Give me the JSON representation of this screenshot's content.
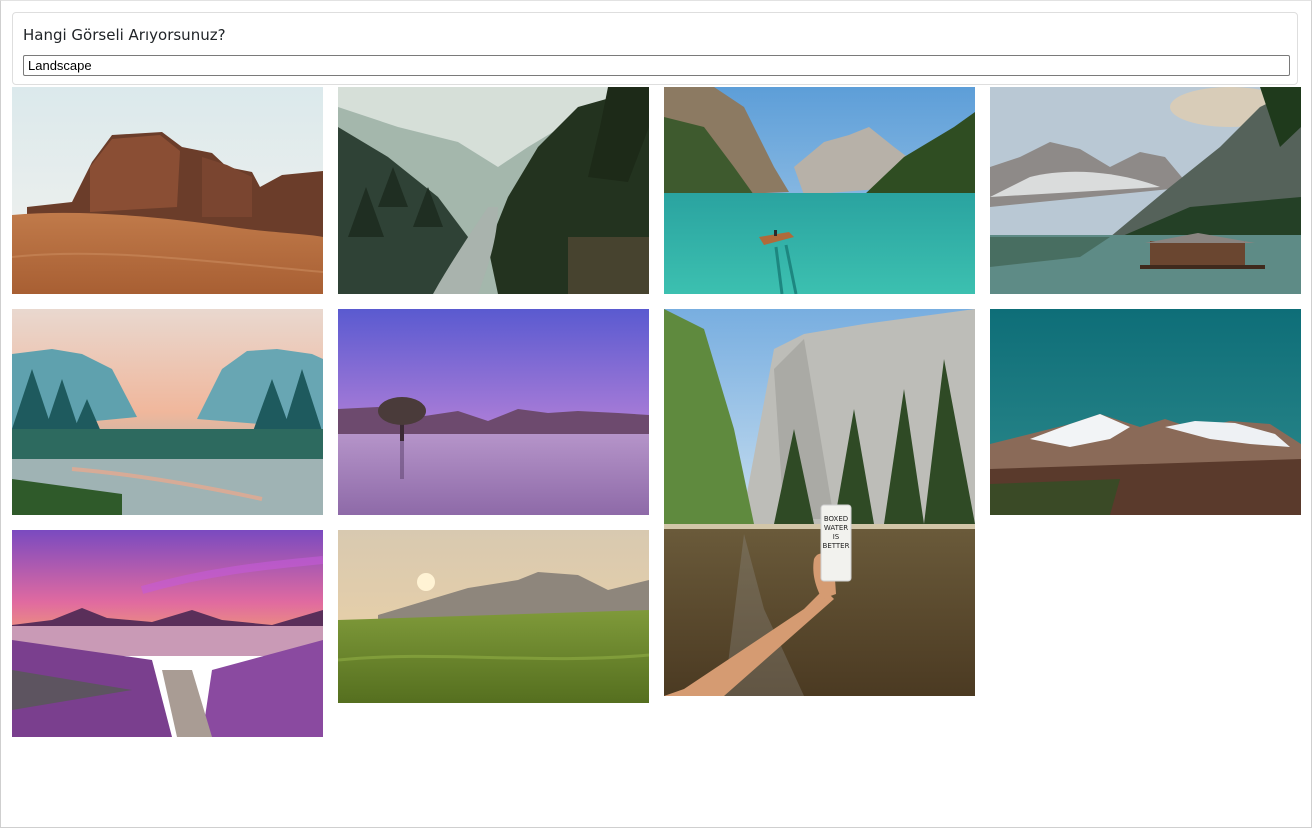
{
  "search": {
    "title": "Hangi Görseli Arıyorsunuz?",
    "value": "Landscape"
  },
  "images": [
    {
      "subject": "desert-rocks-photo"
    },
    {
      "subject": "misty-forest-river-photo"
    },
    {
      "subject": "turquoise-lake-boat-photo"
    },
    {
      "subject": "mountain-lake-cabin-photo"
    },
    {
      "subject": "valley-sunrise-river-photo"
    },
    {
      "subject": "purple-lake-tree-photo"
    },
    {
      "subject": "el-capitan-boxed-water-photo",
      "label": [
        "BOXED",
        "WATER",
        "IS",
        "BETTER"
      ]
    },
    {
      "subject": "snowy-mountains-teal-sky-photo"
    },
    {
      "subject": "lavender-sunset-lake-photo"
    },
    {
      "subject": "meadow-sunset-mountains-photo"
    }
  ]
}
